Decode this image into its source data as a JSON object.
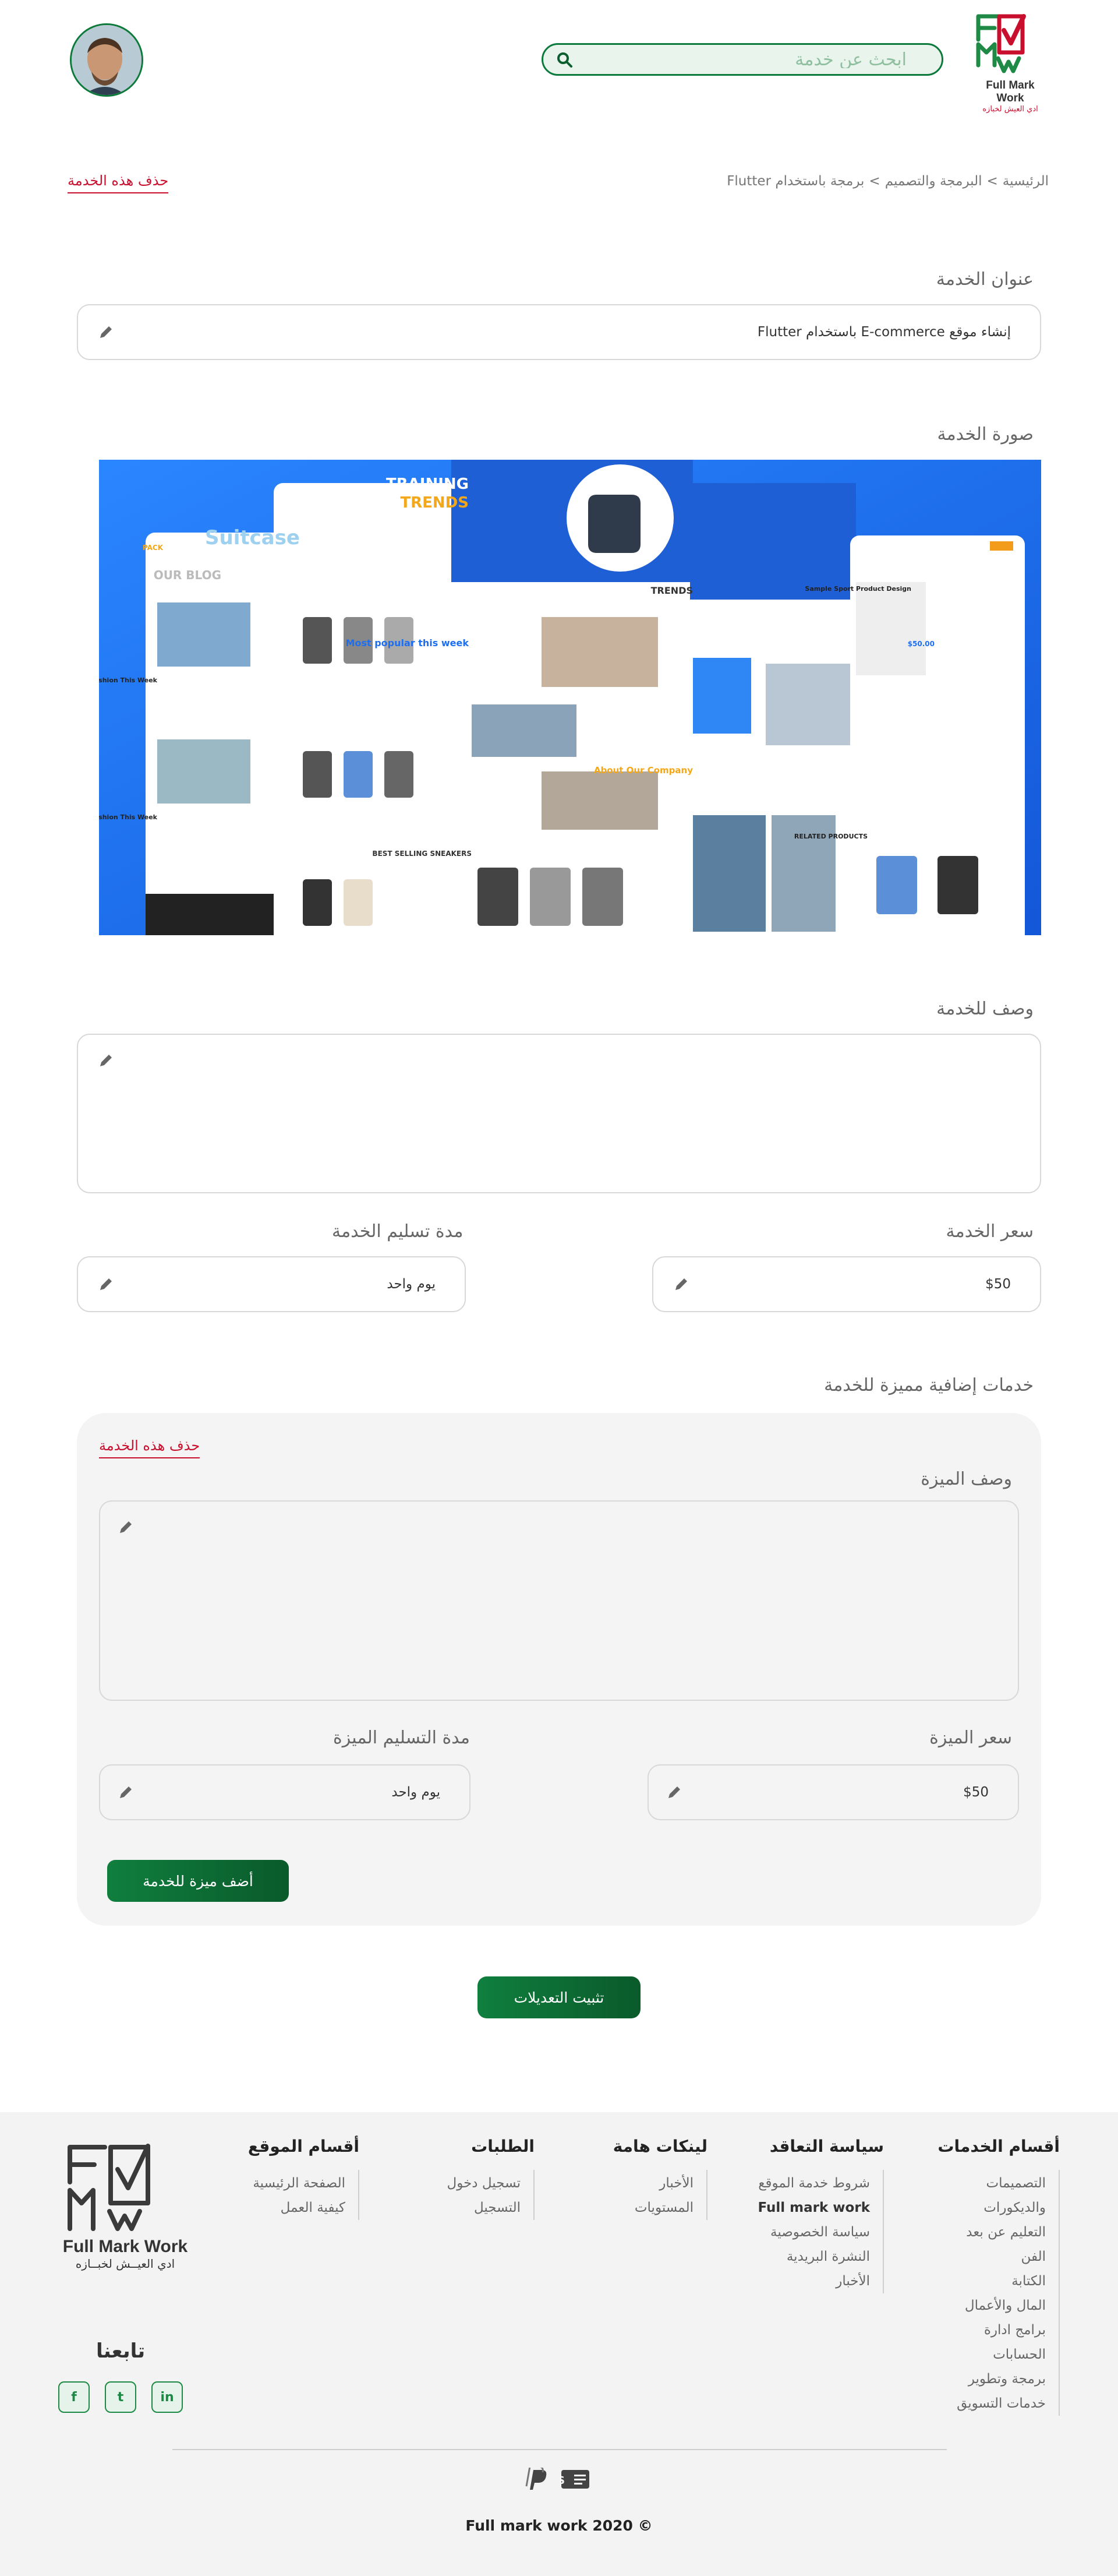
{
  "header": {
    "logo_text": "Full Mark Work",
    "logo_tagline": "ادي العيش لخبازه",
    "search_placeholder": "ابحث عن خدمة"
  },
  "breadcrumb": [
    "الرئيسية",
    "البرمجة والتصميم",
    "برمجة باستخدام Flutter"
  ],
  "breadcrumb_sep": ">",
  "delete_service": "حذف هذه الخدمة",
  "service": {
    "title_label": "عنوان الخدمة",
    "title_value": "إنشاء موقع E-commerce باستخدام Flutter",
    "image_label": "صورة الخدمة",
    "image": {
      "card_blog": "OUR BLOG",
      "card_suitcase": "Suitcase",
      "training_1": "TRAINING",
      "training_2": "TRENDS",
      "popular": "Most popular this week",
      "best_selling": "BEST SELLING SNEAKERS",
      "trends": "TRENDS",
      "about": "About Our Company",
      "product": "Sample Sport Product Design",
      "price": "$50.00",
      "related": "RELATED PRODUCTS",
      "fashion_1": "Fashion This Week",
      "fashion_2": "Fashion This Week",
      "brand": "PACK"
    },
    "description_label": "وصف للخدمة",
    "price_label": "سعر الخدمة",
    "price_value": "$50",
    "delivery_label": "مدة تسليم الخدمة",
    "delivery_value": "يوم واحد"
  },
  "extras": {
    "section_label": "خدمات إضافية مميزة للخدمة",
    "delete_label": "حذف هذه الخدمة",
    "feature_desc_label": "وصف الميزة",
    "feature_price_label": "سعر الميزة",
    "feature_price_value": "$50",
    "feature_delivery_label": "مدة التسليم الميزة",
    "feature_delivery_value": "يوم واحد",
    "add_button": "أضف ميزة للخدمة"
  },
  "save_button": "تثبيت التعديلات",
  "footer": {
    "columns": [
      {
        "title": "أقسام الخدمات",
        "items": [
          "التصميمات",
          "والديكورات",
          "التعليم عن بعد",
          "الفن",
          "الكتابة",
          "المال والأعمال",
          "برامج ادارة",
          "الحسابات",
          "برمجة وتطوير",
          "خدمات التسويق"
        ]
      },
      {
        "title": "سياسة التعاقد",
        "items": [
          "شروط خدمة الموقع",
          "Full mark work",
          "سياسة الخصوصية",
          "النشرة البريدية",
          "الأخبار"
        ]
      },
      {
        "title": "لينكات هامة",
        "items": [
          "الأخبار",
          "المستويات"
        ]
      },
      {
        "title": "الطلبات",
        "items": [
          "تسجيل دخول",
          "التسجيل"
        ]
      },
      {
        "title": "أقسام الموقع",
        "items": [
          "الصفحة الرئيسية",
          "كيفية العمل"
        ]
      }
    ],
    "logo_text": "Full Mark Work",
    "logo_tagline": "ادي العيــش لخبــازه",
    "follow_label": "تابعنا",
    "socials": [
      "f",
      "t",
      "in"
    ],
    "copyright": "Full mark work 2020 ©"
  },
  "colors": {
    "brand_green": "#0b7a3a",
    "danger": "#c8102e",
    "hero_blue": "#1e6ff0"
  }
}
